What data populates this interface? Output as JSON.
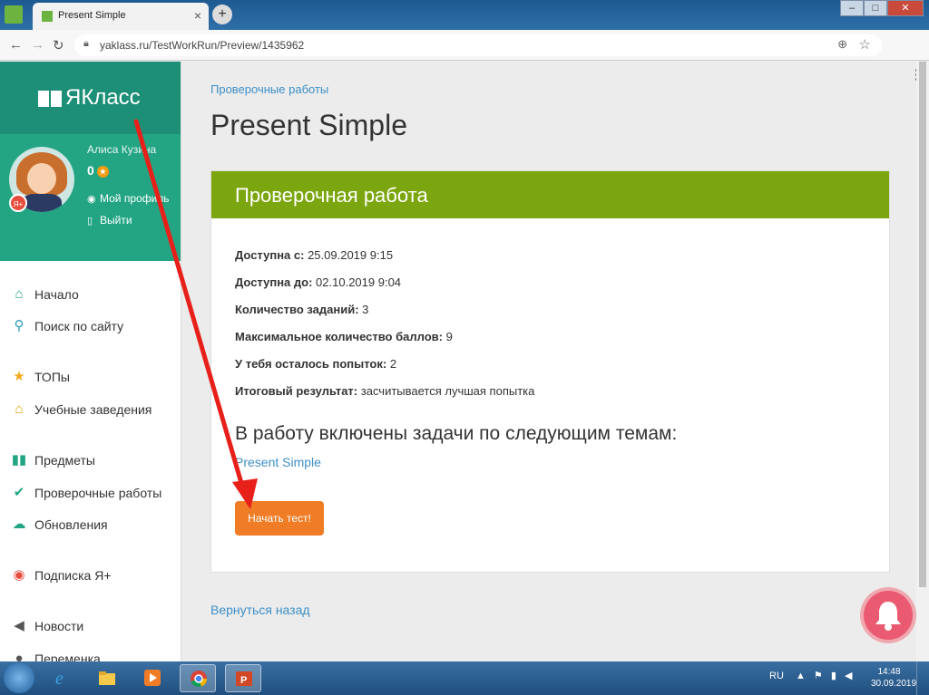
{
  "browser": {
    "tab_title": "Present Simple",
    "tab_close": "×",
    "new_tab": "+",
    "url": "yaklass.ru/TestWorkRun/Preview/1435962",
    "window_controls": [
      "–",
      "□",
      "✕"
    ]
  },
  "sidebar": {
    "logo": "ЯКласс",
    "user": {
      "name": "Алиса Кузина",
      "coins": "0",
      "badge": "Я+",
      "profile_link": "Мой профиль",
      "logout_link": "Выйти"
    },
    "items": [
      {
        "label": "Начало",
        "icon": "home-icon"
      },
      {
        "label": "Поиск по сайту",
        "icon": "search-icon"
      },
      {
        "label": "ТОПы",
        "icon": "star-icon"
      },
      {
        "label": "Учебные заведения",
        "icon": "school-icon"
      },
      {
        "label": "Предметы",
        "icon": "books-icon"
      },
      {
        "label": "Проверочные работы",
        "icon": "check-circle-icon"
      },
      {
        "label": "Обновления",
        "icon": "cloud-icon"
      },
      {
        "label": "Подписка Я+",
        "icon": "subscription-icon"
      },
      {
        "label": "Новости",
        "icon": "megaphone-icon"
      },
      {
        "label": "Переменка",
        "icon": "person-icon"
      }
    ]
  },
  "main": {
    "breadcrumb": "Проверочные работы",
    "title": "Present Simple",
    "card": {
      "header": "Проверочная работа",
      "info": [
        {
          "label": "Доступна с:",
          "value": "25.09.2019 9:15"
        },
        {
          "label": "Доступна до:",
          "value": "02.10.2019 9:04"
        },
        {
          "label": "Количество заданий:",
          "value": "3"
        },
        {
          "label": "Максимальное количество баллов:",
          "value": "9"
        },
        {
          "label": "У тебя осталось попыток:",
          "value": "2"
        },
        {
          "label": "Итоговый результат:",
          "value": "засчитывается лучшая попытка"
        }
      ],
      "topics_title": "В работу включены задачи по следующим темам:",
      "topic": "Present Simple",
      "start_button": "Начать тест!"
    },
    "back_link": "Вернуться назад"
  },
  "taskbar": {
    "language": "RU",
    "time": "14:48",
    "date": "30.09.2019"
  },
  "colors": {
    "sidebar_dark": "#1d8f76",
    "sidebar_light": "#23a584",
    "card_header": "#7ca60f",
    "start_button": "#f07c26",
    "link": "#3d8fc6",
    "annotation_arrow": "#e8201a"
  }
}
